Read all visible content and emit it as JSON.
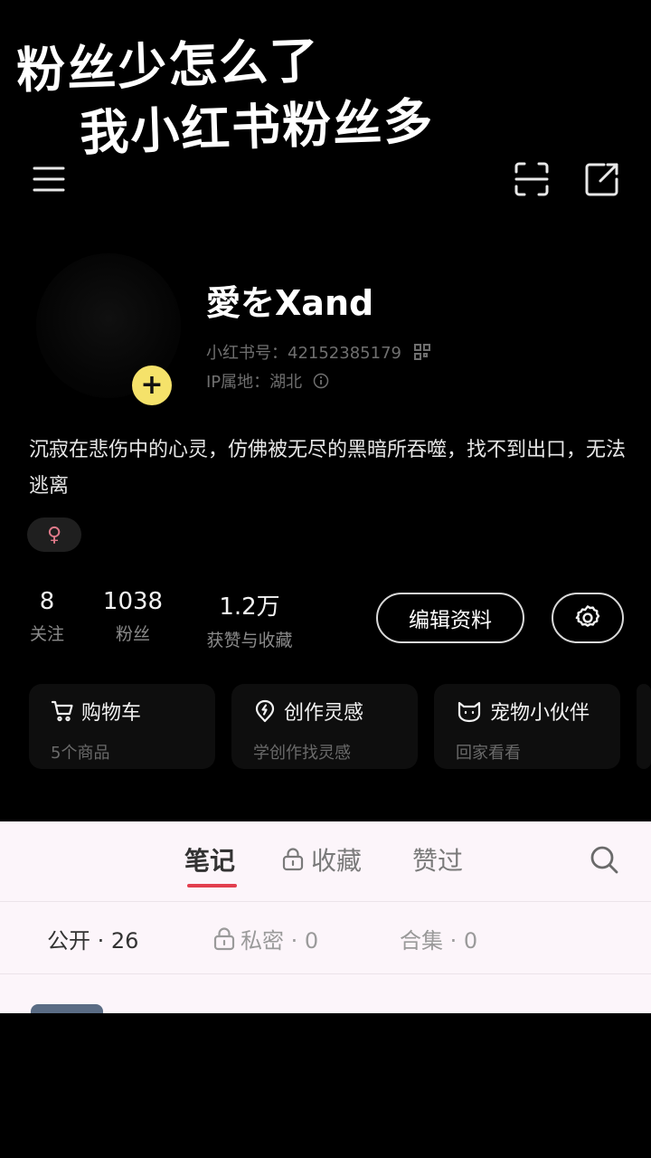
{
  "caption": {
    "line1": "粉丝少怎么了",
    "line2": "我小红书粉丝多"
  },
  "profile": {
    "username": "愛をXand",
    "id_label": "小红书号：42152385179",
    "ip_label": "IP属地：湖北",
    "bio": "沉寂在悲伤中的心灵，仿佛被无尽的黑暗所吞噬，找不到出口，无法逃离",
    "gender_symbol": "♀",
    "add_symbol": "+"
  },
  "stats": [
    {
      "value": "8",
      "label": "关注"
    },
    {
      "value": "1038",
      "label": "粉丝"
    },
    {
      "value": "1.2万",
      "label": "获赞与收藏"
    }
  ],
  "actions": {
    "edit_label": "编辑资料"
  },
  "cards": [
    {
      "title": "购物车",
      "subtitle": "5个商品",
      "icon": "cart-icon"
    },
    {
      "title": "创作灵感",
      "subtitle": "学创作找灵感",
      "icon": "bulb-icon"
    },
    {
      "title": "宠物小伙伴",
      "subtitle": "回家看看",
      "icon": "cat-icon"
    }
  ],
  "tabs": [
    {
      "label": "笔记",
      "active": true
    },
    {
      "label": "收藏",
      "locked": true
    },
    {
      "label": "赞过"
    }
  ],
  "filters": [
    {
      "label": "公开 · 26",
      "active": true
    },
    {
      "label": "私密 · 0",
      "locked": true
    },
    {
      "label": "合集 · 0"
    }
  ],
  "colors": {
    "accent": "#e23e4e",
    "badge": "#f5e26a",
    "panel_bg": "#fcf5fa"
  }
}
